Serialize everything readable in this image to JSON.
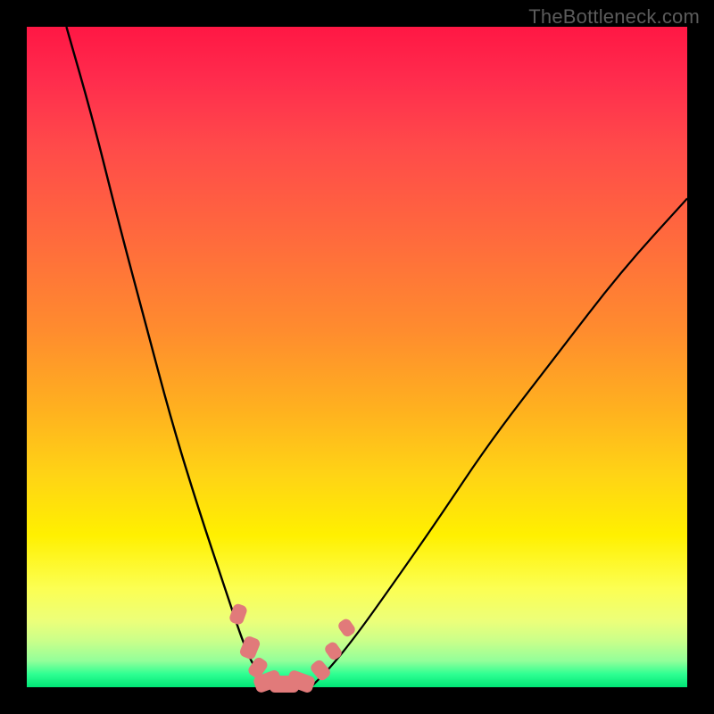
{
  "watermark": "TheBottleneck.com",
  "colors": {
    "frame": "#000000",
    "curve": "#000000",
    "bead": "#e17a7a",
    "gradient_stops": [
      "#ff1744",
      "#ff2c4d",
      "#ff4a4a",
      "#ff6a3d",
      "#ff8c2e",
      "#ffb11f",
      "#ffd415",
      "#fff000",
      "#fcff52",
      "#ecff7a",
      "#caff8a",
      "#93ff9a",
      "#2fff92",
      "#00e676"
    ]
  },
  "chart_data": {
    "type": "line",
    "title": "",
    "xlabel": "",
    "ylabel": "",
    "xlim": [
      0,
      100
    ],
    "ylim": [
      0,
      100
    ],
    "grid": false,
    "legend": false,
    "series": [
      {
        "name": "left-curve",
        "x": [
          6,
          10,
          14,
          18,
          22,
          26,
          30,
          33,
          35,
          37
        ],
        "y": [
          100,
          86,
          70,
          55,
          40,
          27,
          15,
          6,
          2,
          0
        ]
      },
      {
        "name": "right-curve",
        "x": [
          43,
          46,
          50,
          55,
          62,
          70,
          80,
          90,
          100
        ],
        "y": [
          0,
          3,
          8,
          15,
          25,
          37,
          50,
          63,
          74
        ]
      }
    ],
    "annotations": {
      "green_band_y_range": [
        0,
        4
      ],
      "beads": [
        {
          "along": "left-curve",
          "x": 32.0,
          "y": 11.0,
          "w": 3.0,
          "h": 2.2,
          "angle": -70
        },
        {
          "along": "left-curve",
          "x": 33.8,
          "y": 6.0,
          "w": 3.2,
          "h": 2.4,
          "angle": -68
        },
        {
          "along": "left-curve",
          "x": 35.0,
          "y": 3.0,
          "w": 3.0,
          "h": 2.2,
          "angle": -55
        },
        {
          "along": "floor",
          "x": 36.5,
          "y": 0.8,
          "w": 4.0,
          "h": 2.6,
          "angle": -20
        },
        {
          "along": "floor",
          "x": 39.0,
          "y": 0.5,
          "w": 4.5,
          "h": 2.6,
          "angle": 0
        },
        {
          "along": "floor",
          "x": 41.5,
          "y": 0.8,
          "w": 4.0,
          "h": 2.6,
          "angle": 20
        },
        {
          "along": "right-curve",
          "x": 44.5,
          "y": 2.5,
          "w": 3.0,
          "h": 2.2,
          "angle": 50
        },
        {
          "along": "right-curve",
          "x": 46.5,
          "y": 5.5,
          "w": 2.6,
          "h": 2.0,
          "angle": 55
        },
        {
          "along": "right-curve",
          "x": 48.5,
          "y": 9.0,
          "w": 2.6,
          "h": 2.0,
          "angle": 55
        }
      ]
    }
  }
}
